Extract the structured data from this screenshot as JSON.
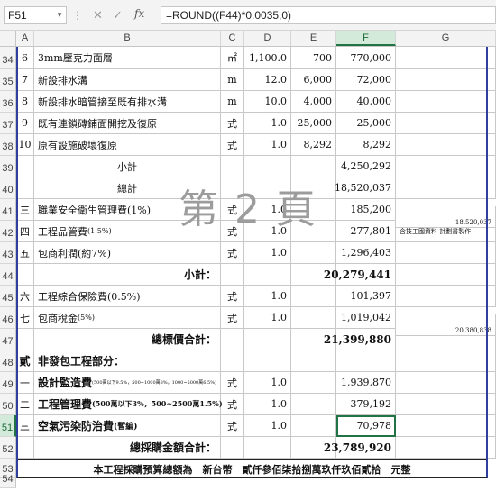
{
  "formula_bar": {
    "name_box": "F51",
    "formula": "=ROUND((F44)*0.0035,0)",
    "cancel_icon": "close-icon",
    "enter_icon": "check-icon",
    "fx_label": "fx"
  },
  "columns": [
    "A",
    "B",
    "C",
    "D",
    "E",
    "F",
    "G"
  ],
  "watermark": "第 2 頁",
  "rows": {
    "r34": {
      "num": "34",
      "a": "6",
      "b": "3mm壓克力面層",
      "c": "㎡",
      "d": "1,100.0",
      "e": "700",
      "f": "770,000",
      "g": ""
    },
    "r35": {
      "num": "35",
      "a": "7",
      "b": "新設排水溝",
      "c": "m",
      "d": "12.0",
      "e": "6,000",
      "f": "72,000",
      "g": ""
    },
    "r36": {
      "num": "36",
      "a": "8",
      "b": "新設排水暗管接至既有排水溝",
      "c": "m",
      "d": "10.0",
      "e": "4,000",
      "f": "40,000",
      "g": ""
    },
    "r37": {
      "num": "37",
      "a": "9",
      "b": "既有連鎖磚鋪面開挖及復原",
      "c": "式",
      "d": "1.0",
      "e": "25,000",
      "f": "25,000",
      "g": ""
    },
    "r38": {
      "num": "38",
      "a": "10",
      "b": "原有設施破壞復原",
      "c": "式",
      "d": "1.0",
      "e": "8,292",
      "f": "8,292",
      "g": ""
    },
    "r39": {
      "num": "39",
      "b": "小計",
      "f": "4,250,292"
    },
    "r40": {
      "num": "40",
      "b": "總計",
      "f": "18,520,037"
    },
    "r41": {
      "num": "41",
      "a": "三",
      "b": "職業安全衛生管理費(1%)",
      "c": "式",
      "d": "1.0",
      "f": "185,200",
      "g": "18,520,037"
    },
    "r42": {
      "num": "42",
      "a": "四",
      "b": "工程品管費",
      "b_small": "(1.5%)",
      "c": "式",
      "d": "1.0",
      "f": "277,801",
      "g": "含技工國資料 計劃書製作"
    },
    "r43": {
      "num": "43",
      "a": "五",
      "b": "包商利潤(約7%)",
      "c": "式",
      "d": "1.0",
      "f": "1,296,403"
    },
    "r44": {
      "num": "44",
      "b": "小計：",
      "f": "20,279,441"
    },
    "r45": {
      "num": "45",
      "a": "六",
      "b": "工程綜合保險費(0.5%)",
      "c": "式",
      "d": "1.0",
      "f": "101,397"
    },
    "r46": {
      "num": "46",
      "a": "七",
      "b": "包商稅金",
      "b_small": "(5%)",
      "c": "式",
      "d": "1.0",
      "f": "1,019,042",
      "g": "20,380,838"
    },
    "r47": {
      "num": "47",
      "b": "總標價合計：",
      "f": "21,399,880"
    },
    "r48": {
      "num": "48",
      "a": "貳",
      "b": "非發包工程部分："
    },
    "r49": {
      "num": "49",
      "a": "一",
      "b": "設計監造費",
      "b_small": "(500萬以下9.5%，500~1000萬8%，1000~5000萬6.5%)",
      "c": "式",
      "d": "1.0",
      "f": "1,939,870"
    },
    "r50": {
      "num": "50",
      "a": "二",
      "b": "工程管理費",
      "b_small": "(500萬以下3%，500~2500萬1.5%)",
      "c": "式",
      "d": "1.0",
      "f": "379,192"
    },
    "r51": {
      "num": "51",
      "a": "三",
      "b": "空氣污染防治費",
      "b_small": "(暫編)",
      "c": "式",
      "d": "1.0",
      "f": "70,978"
    },
    "r52": {
      "num": "52",
      "b": "總採購金額合計：",
      "f": "23,789,920"
    },
    "r53": {
      "num": "53",
      "note": "本工程採購預算總額為　新台幣　貳仟參佰柒拾捌萬玖仟玖佰貳拾　元整"
    },
    "r54": {
      "num": "54"
    }
  }
}
